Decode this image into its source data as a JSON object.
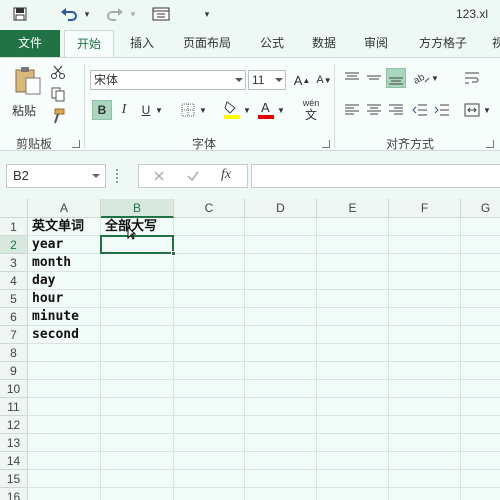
{
  "window": {
    "filename": "123.xl"
  },
  "qat": {
    "dropdown_symbol": "▾"
  },
  "tabs": [
    {
      "label": "文件"
    },
    {
      "label": "开始"
    },
    {
      "label": "插入"
    },
    {
      "label": "页面布局"
    },
    {
      "label": "公式"
    },
    {
      "label": "数据"
    },
    {
      "label": "审阅"
    },
    {
      "label": "方方格子"
    },
    {
      "label": "视"
    }
  ],
  "ribbon": {
    "clipboard": {
      "paste_label": "粘贴",
      "group_label": "剪贴板"
    },
    "font": {
      "font_name": "宋体",
      "font_size": "11",
      "bold": "B",
      "italic": "I",
      "underline": "U",
      "wen_top": "wén",
      "wen_bottom": "文",
      "group_label": "字体",
      "fill_color": "#ffff00",
      "font_color": "#e60000"
    },
    "alignment": {
      "group_label": "对齐方式"
    }
  },
  "formula_bar": {
    "name_box": "B2",
    "fx": "fx",
    "value": ""
  },
  "sheet": {
    "columns": [
      "A",
      "B",
      "C",
      "D",
      "E",
      "F",
      "G"
    ],
    "selected_column": "B",
    "rows": [
      "1",
      "2",
      "3",
      "4",
      "5",
      "6",
      "7",
      "8",
      "9",
      "10",
      "11",
      "12",
      "13",
      "14",
      "15",
      "16"
    ],
    "selected_row": "2",
    "cells": {
      "A1": "英文单词",
      "B1": "全部大写",
      "A2": "year",
      "A3": "month",
      "A4": "day",
      "A5": "hour",
      "A6": "minute",
      "A7": "second"
    },
    "active_cell": "B2",
    "accent": "#217346"
  }
}
